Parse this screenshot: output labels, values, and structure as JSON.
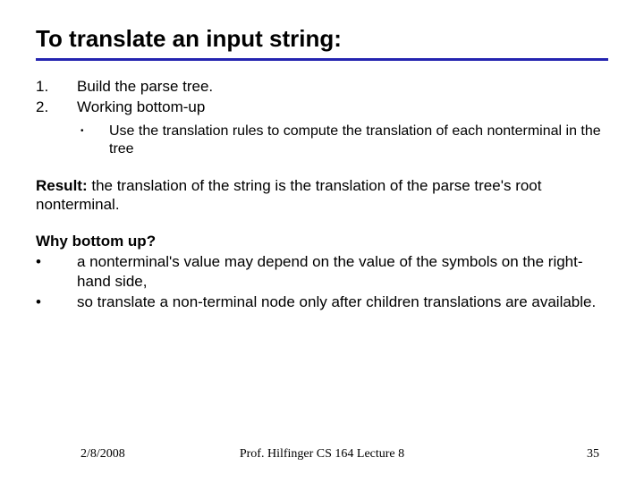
{
  "title": "To translate an input string:",
  "ol": [
    {
      "n": "1.",
      "t": "Build the parse tree."
    },
    {
      "n": "2.",
      "t": "Working bottom-up"
    }
  ],
  "sub": {
    "b": "•",
    "t": "Use the translation rules to compute the translation of each nonterminal in the tree"
  },
  "result_label": "Result:",
  "result_text": " the translation of the string is the translation of the parse tree's root nonterminal.",
  "why_label": "Why bottom up?",
  "why": [
    {
      "b": "•",
      "t": "a nonterminal's value may depend on the value of the symbols on the right-hand side,"
    },
    {
      "b": "•",
      "t": "so translate a non-terminal node only after children translations are available."
    }
  ],
  "footer": {
    "date": "2/8/2008",
    "center": "Prof. Hilfinger CS 164 Lecture 8",
    "page": "35"
  }
}
